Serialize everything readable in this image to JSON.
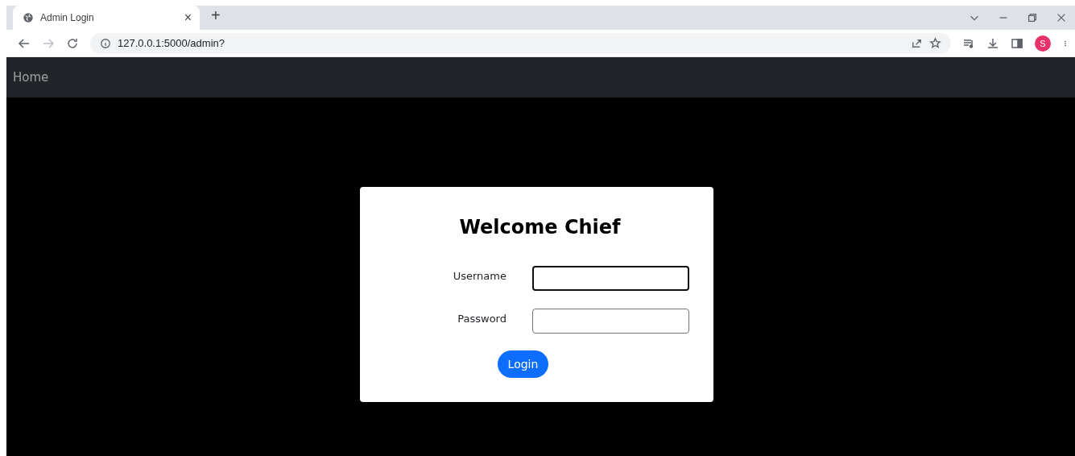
{
  "browser": {
    "tab": {
      "title": "Admin Login",
      "close": "×",
      "selected": true
    },
    "new_tab": "+",
    "address": "127.0.0.1:5000/admin?",
    "profile_initial": "S"
  },
  "navbar": {
    "items": [
      {
        "label": "Home"
      }
    ]
  },
  "login": {
    "title": "Welcome Chief",
    "fields": [
      {
        "label": "Username",
        "focused": true
      },
      {
        "label": "Password",
        "focused": false
      }
    ],
    "button": "Login"
  }
}
